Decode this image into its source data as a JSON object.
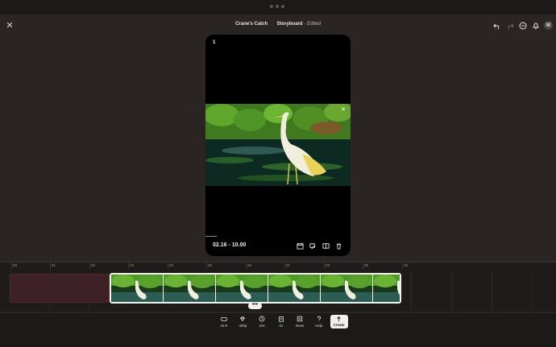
{
  "header": {
    "project_name": "Crane's Catch",
    "separator": "·",
    "view_name": "Storyboard",
    "status": "Edited",
    "status_separator": "·",
    "close_icon": "close-icon",
    "actions": [
      "undo-icon",
      "redo-icon",
      "minus-circle-icon",
      "bell-icon"
    ],
    "avatar_initial": "M"
  },
  "preview": {
    "frame_number": "1",
    "time_range": "02.16 - 10.00",
    "tools": [
      "calendar-icon",
      "caption-icon",
      "split-icon",
      "trash-icon"
    ]
  },
  "timeline": {
    "ruler": [
      "00",
      "01",
      "02",
      "03",
      "04",
      "05",
      "06",
      "07",
      "08",
      "09",
      "10"
    ],
    "more_label": "•••"
  },
  "toolbar": {
    "items": [
      {
        "icon": "aspect-ratio-icon",
        "label": "16:9"
      },
      {
        "icon": "diamond-icon",
        "label": "480p"
      },
      {
        "icon": "clock-icon",
        "label": "10s"
      },
      {
        "icon": "copies-icon",
        "label": "4v"
      },
      {
        "icon": "style-icon",
        "label": "None"
      },
      {
        "icon": "help-icon",
        "label": "Help"
      }
    ],
    "create_label": "Create"
  },
  "colors": {
    "background": "#2a2522",
    "timeline_bg": "#1e1b1a",
    "empty_clip": "#3e2126",
    "accent_light": "#f3f1ee"
  }
}
